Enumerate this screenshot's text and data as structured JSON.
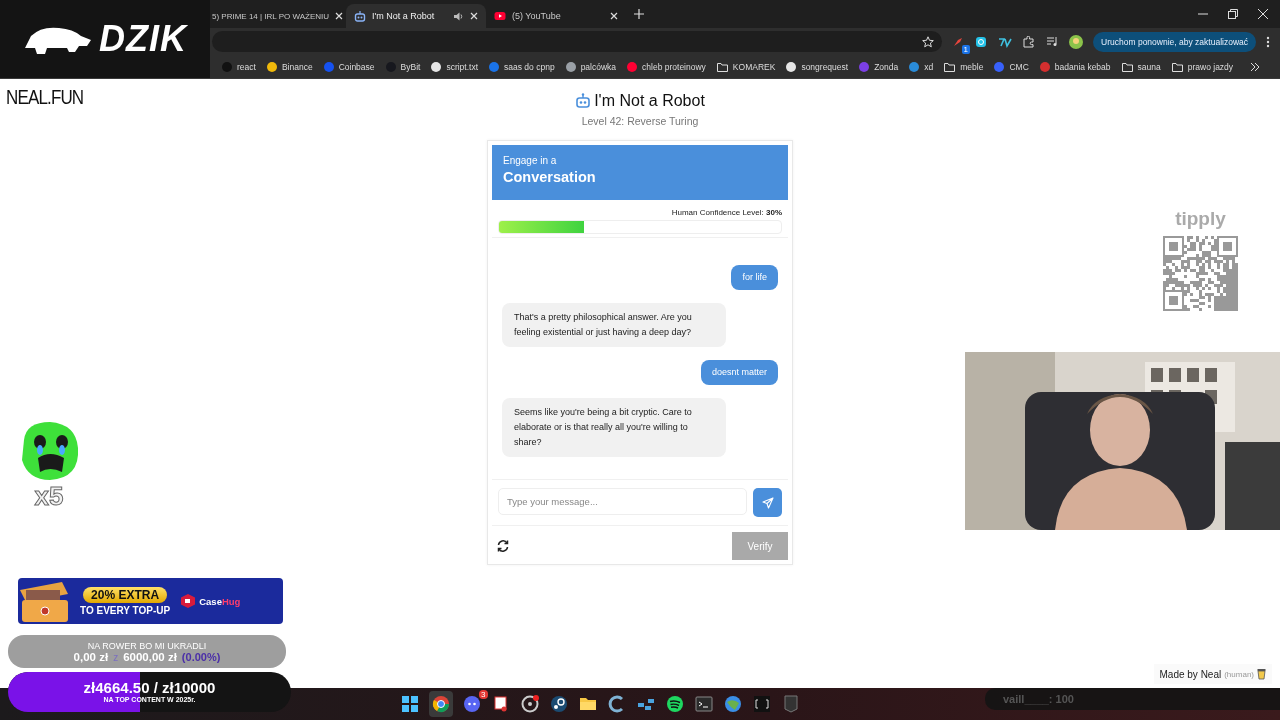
{
  "overlay_logo": {
    "text": "DZIK"
  },
  "tabs": [
    {
      "title": "5) PRIME 14 | IRL PO WAŻENIU",
      "selected": false,
      "kind": "plain",
      "audio": false
    },
    {
      "title": "I'm Not a Robot",
      "selected": true,
      "kind": "robot",
      "audio": true
    },
    {
      "title": "(5) YouTube",
      "selected": false,
      "kind": "video",
      "audio": false
    }
  ],
  "toolbar": {
    "extension_badge": "1",
    "update_button": "Uruchom ponownie, aby zaktualizować"
  },
  "bookmarks": [
    {
      "label": "react",
      "kind": "site",
      "color": "#111111"
    },
    {
      "label": "Binance",
      "kind": "site",
      "color": "#f0b90b"
    },
    {
      "label": "Coinbase",
      "kind": "site",
      "color": "#1652f0"
    },
    {
      "label": "ByBit",
      "kind": "site",
      "color": "#17181e"
    },
    {
      "label": "script.txt",
      "kind": "site",
      "color": "#e6e6e6"
    },
    {
      "label": "saas do cpnp",
      "kind": "site",
      "color": "#1a73e8"
    },
    {
      "label": "palcówka",
      "kind": "site",
      "color": "#9aa0a6"
    },
    {
      "label": "chleb proteinowy",
      "kind": "site",
      "color": "#ff0033"
    },
    {
      "label": "KOMAREK",
      "kind": "folder"
    },
    {
      "label": "songrequest",
      "kind": "site",
      "color": "#e6e6e6"
    },
    {
      "label": "Zonda",
      "kind": "site",
      "color": "#7b3fe4"
    },
    {
      "label": "xd",
      "kind": "site",
      "color": "#2a8bd8"
    },
    {
      "label": "meble",
      "kind": "folder"
    },
    {
      "label": "CMC",
      "kind": "site",
      "color": "#3861fb"
    },
    {
      "label": "badania kebab",
      "kind": "site",
      "color": "#d32f2f"
    },
    {
      "label": "sauna",
      "kind": "folder"
    },
    {
      "label": "prawo jazdy",
      "kind": "folder"
    }
  ],
  "page": {
    "logo": "NEAL.FUN",
    "title": "I'm Not a Robot",
    "subtitle": "Level 42: Reverse Turing",
    "card": {
      "header_small": "Engage in a",
      "header_large": "Conversation",
      "confidence": {
        "label": "Human Confidence Level:",
        "value": "30%",
        "level": 0.3
      },
      "messages": [
        {
          "kind": "user",
          "text": "for life"
        },
        {
          "kind": "bot",
          "text": "That's a pretty philosophical answer. Are you feeling existential or just having a deep day?"
        },
        {
          "kind": "user",
          "text": "doesnt matter"
        },
        {
          "kind": "bot",
          "text": "Seems like you're being a bit cryptic. Care to elaborate or is that really all you're willing to share?"
        }
      ],
      "input": {
        "placeholder": "Type your message..."
      },
      "verify": {
        "label": "Verify",
        "disabled": true
      }
    }
  },
  "credit": {
    "text": "Made by Neal",
    "note": "(human)"
  },
  "stream": {
    "emote": {
      "count": "x5"
    },
    "promo": {
      "headline": "20% EXTRA",
      "subline": "TO EVERY TOP-UP",
      "brand": [
        "Case",
        "Hug"
      ]
    },
    "goal": {
      "title": "NA ROWER BO MI UKRADLI",
      "raised": "0,00 zł",
      "separator": "z",
      "target": "6000,00 zł",
      "percent": "(0.00%)"
    },
    "donation_bar": {
      "amount": "zł4664.50 / zł10000",
      "caption": "NA TOP CONTENT W 2025r.",
      "level": 0.466
    },
    "tipply": {
      "logo": "tipply"
    },
    "chat_message": {
      "text": "vaill____: 100"
    }
  },
  "taskbar": {
    "chat_badge": "3"
  }
}
